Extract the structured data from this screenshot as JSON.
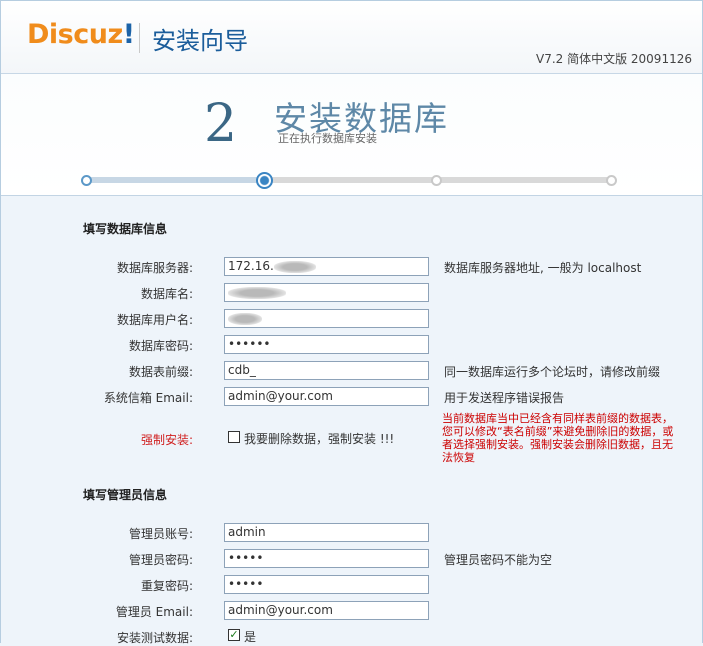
{
  "header": {
    "logo": "Discuz",
    "logo_mark": "!",
    "wizard_title": "安装向导",
    "version": "V7.2 简体中文版 20091126"
  },
  "step": {
    "number": "2",
    "title": "安装数据库",
    "subtitle": "正在执行数据库安装",
    "current_index": 2,
    "total_steps": 4
  },
  "db_section": {
    "title": "填写数据库信息",
    "fields": [
      {
        "label": "数据库服务器:",
        "value": "172.16.",
        "hint": "数据库服务器地址, 一般为 localhost"
      },
      {
        "label": "数据库名:",
        "value": "",
        "hint": ""
      },
      {
        "label": "数据库用户名:",
        "value": "",
        "hint": ""
      },
      {
        "label": "数据库密码:",
        "value": "••••••",
        "hint": ""
      },
      {
        "label": "数据表前缀:",
        "value": "cdb_",
        "hint": "同一数据库运行多个论坛时，请修改前缀"
      },
      {
        "label": "系统信箱 Email:",
        "value": "admin@your.com",
        "hint": "用于发送程序错误报告"
      }
    ],
    "force": {
      "label": "强制安装:",
      "checkbox_label": "我要删除数据，强制安装 !!!",
      "checked": false,
      "warning": "当前数据库当中已经含有同样表前缀的数据表，您可以修改“表名前缀”来避免删除旧的数据，或者选择强制安装。强制安装会删除旧数据，且无法恢复"
    }
  },
  "admin_section": {
    "title": "填写管理员信息",
    "fields": [
      {
        "label": "管理员账号:",
        "value": "admin",
        "hint": ""
      },
      {
        "label": "管理员密码:",
        "value": "•••••",
        "hint": "管理员密码不能为空"
      },
      {
        "label": "重复密码:",
        "value": "•••••",
        "hint": ""
      },
      {
        "label": "管理员 Email:",
        "value": "admin@your.com",
        "hint": ""
      }
    ],
    "test_data": {
      "label": "安装测试数据:",
      "checkbox_label": "是",
      "checked": true,
      "check_glyph": "✓"
    }
  }
}
